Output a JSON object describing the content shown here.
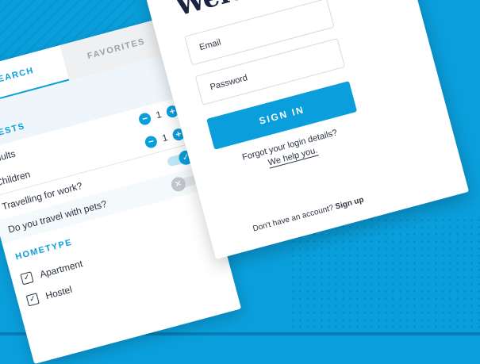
{
  "login": {
    "title": "Welcome!",
    "email_placeholder": "Email",
    "password_placeholder": "Password",
    "signin_label": "SIGN IN",
    "forgot_line1": "Forgot your login details?",
    "forgot_line2": "We help you.",
    "no_account": "Don't have an account?",
    "signup_label": "Sign up"
  },
  "search_panel": {
    "tabs": [
      {
        "label": "SEARCH"
      },
      {
        "label": "FAVORITES"
      }
    ],
    "guests_title": "GUESTS",
    "adults_label": "Adults",
    "adults_count": "1",
    "children_label": "Children",
    "children_count": "1",
    "work_label": "Travelling for work?",
    "pets_label": "Do you travel with pets?",
    "hometype_title": "HOMETYPE",
    "hometypes": [
      {
        "label": "Apartment",
        "checked": true
      },
      {
        "label": "Hostel",
        "checked": true
      }
    ]
  },
  "colors": {
    "accent": "#0a9fdc",
    "dark_text": "#1c2340"
  }
}
